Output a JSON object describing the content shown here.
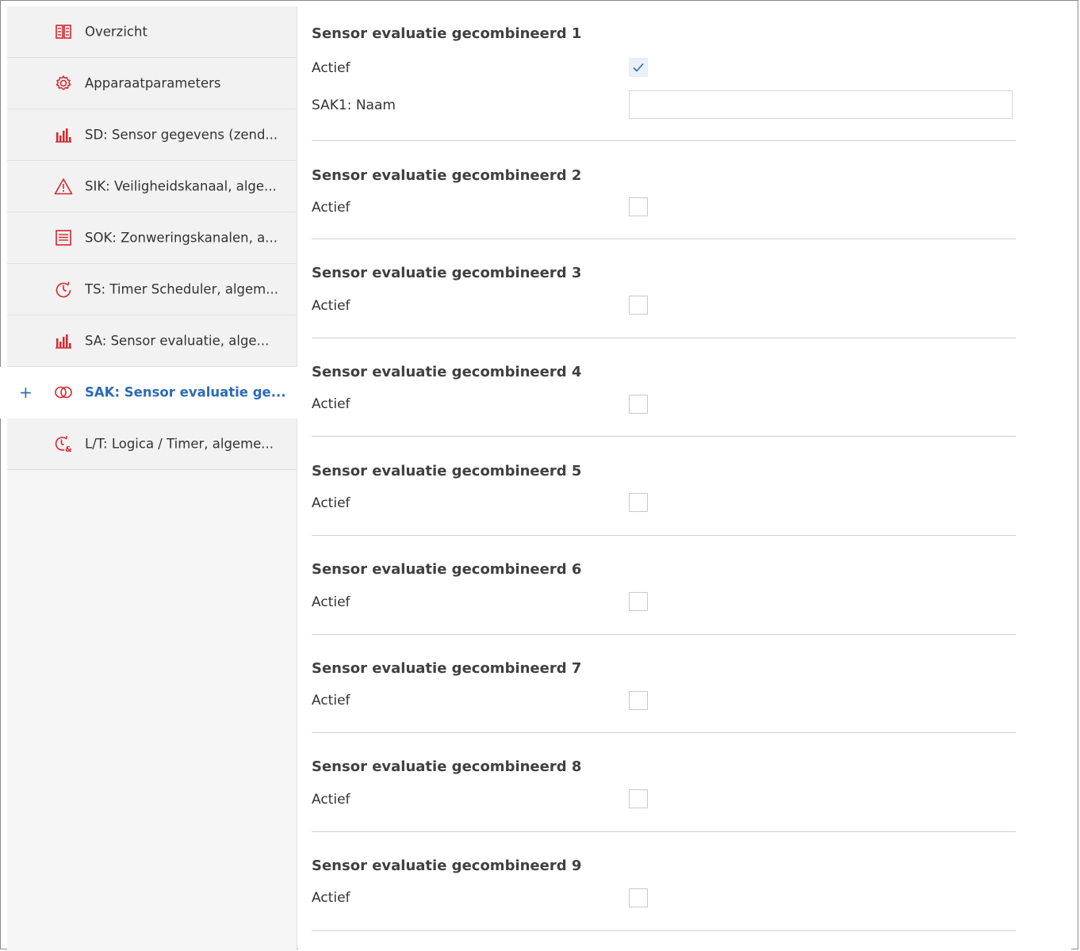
{
  "sidebar": {
    "items": [
      {
        "label": "Overzicht",
        "icon": "book-icon"
      },
      {
        "label": "Apparaatparameters",
        "icon": "gear-icon"
      },
      {
        "label": "SD: Sensor gegevens (zend...",
        "icon": "bar-chart-icon"
      },
      {
        "label": "SIK: Veiligheidskanaal, alge...",
        "icon": "warning-icon"
      },
      {
        "label": "SOK: Zonweringskanalen, a...",
        "icon": "blind-icon"
      },
      {
        "label": "TS: Timer Scheduler, algem...",
        "icon": "timer-icon"
      },
      {
        "label": "SA: Sensor evaluatie, alge...",
        "icon": "bar-chart-icon"
      },
      {
        "label": "SAK: Sensor evaluatie ge...",
        "icon": "linked-circles-icon",
        "active": true,
        "expand": "+"
      },
      {
        "label": "L/T: Logica / Timer, algeme...",
        "icon": "logic-timer-icon"
      }
    ]
  },
  "main": {
    "sections": [
      {
        "title": "Sensor evaluatie gecombineerd 1",
        "active_label": "Actief",
        "checked": true,
        "name_label": "SAK1: Naam",
        "name_value": ""
      },
      {
        "title": "Sensor evaluatie gecombineerd 2",
        "active_label": "Actief",
        "checked": false
      },
      {
        "title": "Sensor evaluatie gecombineerd 3",
        "active_label": "Actief",
        "checked": false
      },
      {
        "title": "Sensor evaluatie gecombineerd 4",
        "active_label": "Actief",
        "checked": false
      },
      {
        "title": "Sensor evaluatie gecombineerd 5",
        "active_label": "Actief",
        "checked": false
      },
      {
        "title": "Sensor evaluatie gecombineerd 6",
        "active_label": "Actief",
        "checked": false
      },
      {
        "title": "Sensor evaluatie gecombineerd 7",
        "active_label": "Actief",
        "checked": false
      },
      {
        "title": "Sensor evaluatie gecombineerd 8",
        "active_label": "Actief",
        "checked": false
      },
      {
        "title": "Sensor evaluatie gecombineerd 9",
        "active_label": "Actief",
        "checked": false
      }
    ]
  },
  "colors": {
    "accent": "#2b6bb5",
    "icon_red": "#d6262e",
    "sidebar_bg": "#f2f2f2"
  }
}
